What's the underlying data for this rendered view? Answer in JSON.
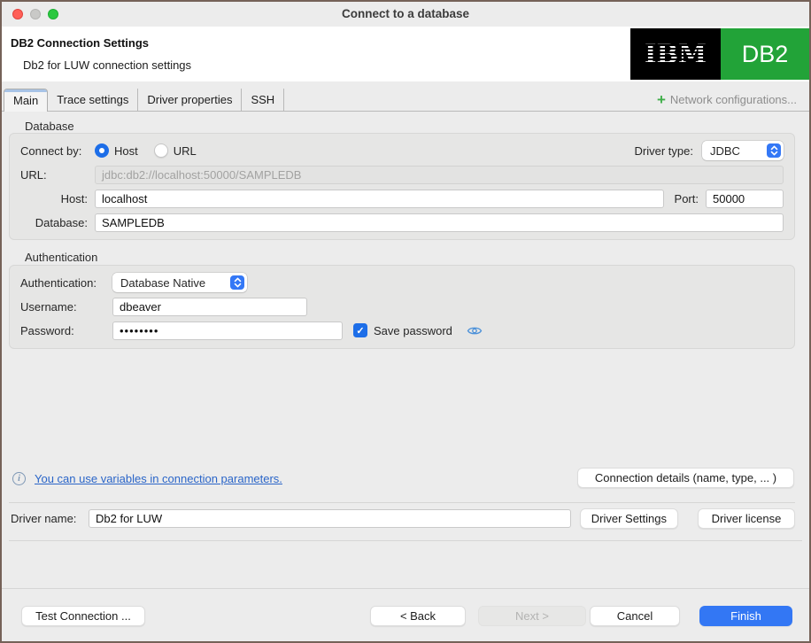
{
  "window": {
    "title": "Connect to a database"
  },
  "header": {
    "title": "DB2 Connection Settings",
    "subtitle": "Db2 for LUW connection settings",
    "logo": {
      "ibm": "IBM",
      "db2": "DB2"
    }
  },
  "tabs": {
    "items": [
      {
        "label": "Main",
        "selected": true
      },
      {
        "label": "Trace settings",
        "selected": false
      },
      {
        "label": "Driver properties",
        "selected": false
      },
      {
        "label": "SSH",
        "selected": false
      }
    ],
    "network_link": "Network configurations..."
  },
  "database": {
    "group_label": "Database",
    "connect_by_label": "Connect by:",
    "radio_host": "Host",
    "radio_url": "URL",
    "driver_type_label": "Driver type:",
    "driver_type_value": "JDBC",
    "url_label": "URL:",
    "url_value": "jdbc:db2://localhost:50000/SAMPLEDB",
    "host_label": "Host:",
    "host_value": "localhost",
    "port_label": "Port:",
    "port_value": "50000",
    "database_label": "Database:",
    "database_value": "SAMPLEDB"
  },
  "authentication": {
    "group_label": "Authentication",
    "auth_label": "Authentication:",
    "auth_value": "Database Native",
    "username_label": "Username:",
    "username_value": "dbeaver",
    "password_label": "Password:",
    "password_value": "••••••••",
    "save_password_label": "Save password"
  },
  "footer": {
    "variables_link": "You can use variables in connection parameters.",
    "connection_details_button": "Connection details (name, type, ... )",
    "driver_name_label": "Driver name:",
    "driver_name_value": "Db2 for LUW",
    "driver_settings_button": "Driver Settings",
    "driver_license_button": "Driver license"
  },
  "actions": {
    "test_connection": "Test Connection ...",
    "back": "< Back",
    "next": "Next >",
    "cancel": "Cancel",
    "finish": "Finish"
  },
  "icons": {
    "plus": "+",
    "info": "i",
    "checkmark": "✓"
  },
  "colors": {
    "accent_blue": "#3377f4",
    "control_blue": "#1d6ee8",
    "link_blue": "#2a65c8",
    "db2_green": "#22a338",
    "plus_green": "#3fae49",
    "traffic_red": "#ff5f57",
    "traffic_gray": "#c9c9c7",
    "traffic_green": "#2bc840"
  }
}
